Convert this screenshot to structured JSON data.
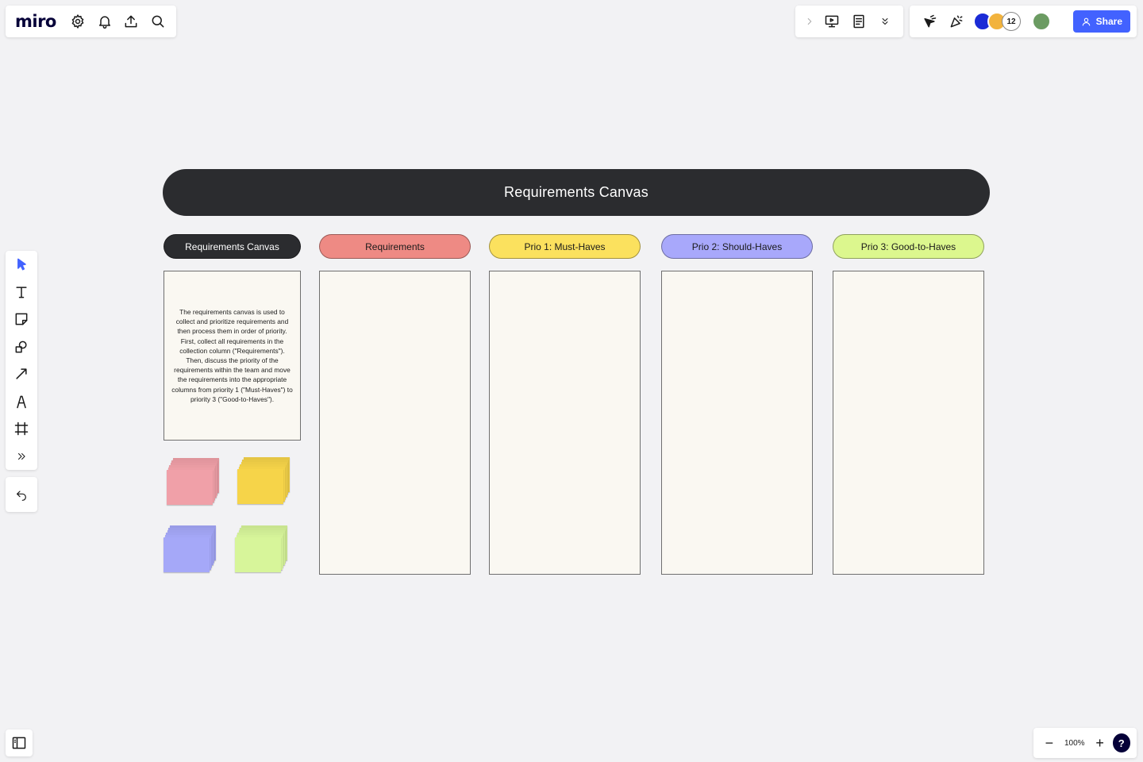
{
  "app": {
    "logo": "miro"
  },
  "top_left": {
    "icons": [
      "settings-icon",
      "bell-icon",
      "upload-icon",
      "search-icon"
    ]
  },
  "top_mid": {
    "icons": [
      "chevron-right-icon",
      "presentation-icon",
      "notes-icon",
      "double-chevron-down-icon"
    ]
  },
  "collaborators": {
    "extra_count": "12"
  },
  "share": {
    "label": "Share"
  },
  "zoom": {
    "level": "100%",
    "minus": "−",
    "plus": "+",
    "help": "?"
  },
  "board": {
    "title": "Requirements Canvas",
    "columns": [
      {
        "label": "Requirements Canvas",
        "color": "#2b2c2f",
        "text_color": "#ffffff"
      },
      {
        "label": "Requirements",
        "color": "#ee8a84",
        "text_color": "#1a1a1a"
      },
      {
        "label": "Prio 1: Must-Haves",
        "color": "#fbe15e",
        "text_color": "#1a1a1a"
      },
      {
        "label": "Prio 2: Should-Haves",
        "color": "#a8a8fb",
        "text_color": "#1a1a1a"
      },
      {
        "label": "Prio 3: Good-to-Haves",
        "color": "#dcf78e",
        "text_color": "#1a1a1a"
      }
    ],
    "description": "The requirements canvas is used to collect and prioritize requirements and then process them in order of priority. First, collect all requirements in the collection column (\"Requirements\"). Then, discuss the priority of the requirements within the team and move the requirements into the appropriate columns from priority 1 (\"Must-Haves\") to priority 3 (\"Good-to-Haves\").",
    "sticky_colors": [
      "#f0a0a8",
      "#f6d449",
      "#a5a8f8",
      "#d7f59a"
    ]
  }
}
